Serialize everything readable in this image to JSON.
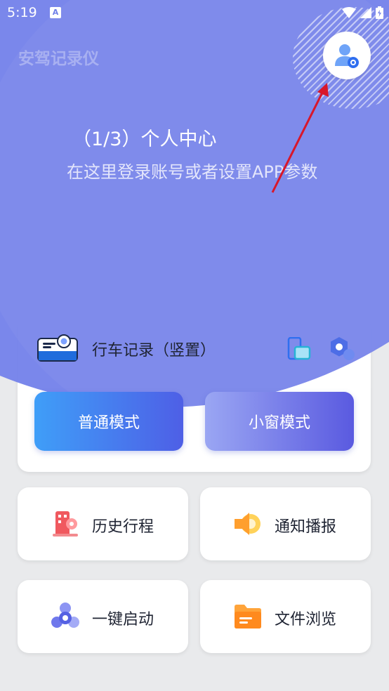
{
  "status_bar": {
    "time": "5:19",
    "badge": "A"
  },
  "header": {
    "app_title": "安驾记录仪"
  },
  "guide": {
    "title": "（1/3）个人中心",
    "description": "在这里登录账号或者设置APP参数"
  },
  "dashcam": {
    "title": "行车记录（竖置）",
    "normal_mode_label": "普通模式",
    "mini_mode_label": "小窗模式"
  },
  "tiles": [
    {
      "label": "历史行程",
      "icon": "building-pin-icon"
    },
    {
      "label": "通知播报",
      "icon": "speaker-icon"
    },
    {
      "label": "一键启动",
      "icon": "quick-start-icon"
    },
    {
      "label": "文件浏览",
      "icon": "folder-icon"
    }
  ],
  "colors": {
    "accent": "#7683ea",
    "button_blue": "#3f9ef8",
    "button_indigo": "#4e5fe6",
    "arrow_red": "#d8172a"
  }
}
